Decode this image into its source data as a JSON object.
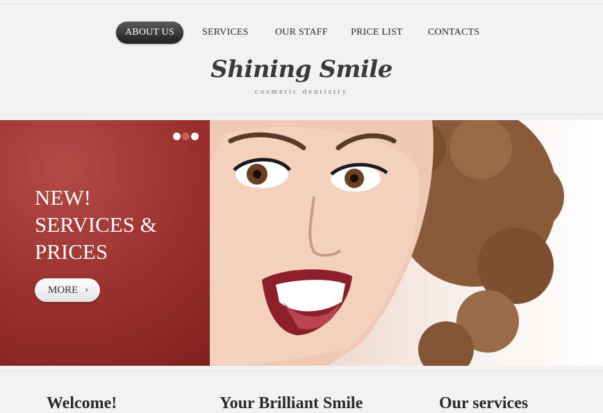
{
  "nav": {
    "items": [
      {
        "label": "ABOUT US",
        "active": true
      },
      {
        "label": "SERVICES"
      },
      {
        "label": "OUR STAFF"
      },
      {
        "label": "PRICE LIST"
      },
      {
        "label": "CONTACTS"
      }
    ]
  },
  "brand": {
    "title": "Shining Smile",
    "subtitle": "cosmetic dentistry"
  },
  "slider": {
    "headline_lines": [
      "NEW!",
      "SERVICES &",
      "PRICES"
    ],
    "more_label": "MORE",
    "dots_count": 3,
    "active_dot": 2
  },
  "bottom": {
    "headings": [
      "Welcome!",
      "Your Brilliant Smile",
      "Our services"
    ]
  },
  "colors": {
    "promo": "#9a302c",
    "nav_active": "#2f2f2f"
  }
}
